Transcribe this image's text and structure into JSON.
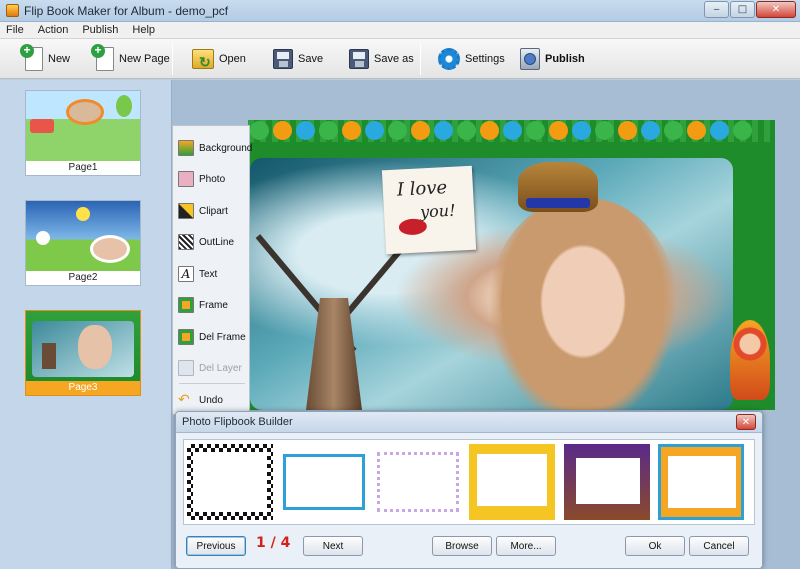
{
  "window": {
    "title": "Flip Book Maker for Album - demo_pcf"
  },
  "menu": [
    "File",
    "Action",
    "Publish",
    "Help"
  ],
  "toolbar": {
    "new": "New",
    "new_page": "New Page",
    "open": "Open",
    "save": "Save",
    "save_as": "Save as",
    "settings": "Settings",
    "publish": "Publish"
  },
  "pages": [
    {
      "label": "Page1"
    },
    {
      "label": "Page2"
    },
    {
      "label": "Page3"
    }
  ],
  "tools": [
    {
      "label": "Background",
      "enabled": true
    },
    {
      "label": "Photo",
      "enabled": true
    },
    {
      "label": "Clipart",
      "enabled": true
    },
    {
      "label": "OutLine",
      "enabled": true
    },
    {
      "label": "Text",
      "enabled": true
    },
    {
      "label": "Frame",
      "enabled": true
    },
    {
      "label": "Del Frame",
      "enabled": true
    },
    {
      "label": "Del Layer",
      "enabled": false
    },
    {
      "label": "Undo",
      "enabled": true
    }
  ],
  "canvas": {
    "note_line1": "I love",
    "note_line2": "you!"
  },
  "dialog": {
    "title": "Photo Flipbook Builder",
    "page_indicator": "1 / 4",
    "buttons": {
      "previous": "Previous",
      "next": "Next",
      "browse": "Browse",
      "more": "More...",
      "ok": "Ok",
      "cancel": "Cancel"
    }
  },
  "colors": {
    "accent_selected": "#f5a623",
    "indicator_red": "#d8201a"
  }
}
